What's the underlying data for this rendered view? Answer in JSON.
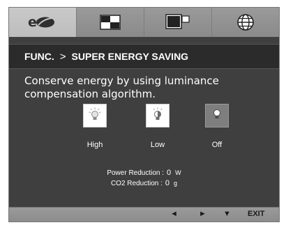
{
  "tabs": [
    {
      "name": "energy-saving-tab",
      "icon": "energy-logo-icon",
      "active": true
    },
    {
      "name": "picture-tab",
      "icon": "picture-split-icon",
      "active": false
    },
    {
      "name": "dual-screen-tab",
      "icon": "dual-screen-icon",
      "active": false
    },
    {
      "name": "language-tab",
      "icon": "globe-icon",
      "active": false
    }
  ],
  "header": {
    "section": "FUNC.",
    "separator": ">",
    "title": "SUPER ENERGY SAVING"
  },
  "description": "Conserve energy by using luminance compensation algorithm.",
  "options": [
    {
      "label": "High",
      "icon": "bulb-high-icon",
      "selected": false
    },
    {
      "label": "Low",
      "icon": "bulb-low-icon",
      "selected": false
    },
    {
      "label": "Off",
      "icon": "bulb-off-icon",
      "selected": true
    }
  ],
  "stats": {
    "power_label": "Power Reduction :",
    "power_value": "0",
    "power_unit": "W",
    "co2_label": "CO2 Reduction :",
    "co2_value": "0",
    "co2_unit": "g"
  },
  "footer": {
    "left": "◄",
    "right": "►",
    "down": "▼",
    "exit": "EXIT"
  },
  "colors": {
    "panel": "#3f3f3f",
    "header_bar": "#2b2b2b",
    "tab_active": "#c4c4c4",
    "tab_inactive": "#8f8f8f",
    "text": "#ffffff"
  }
}
